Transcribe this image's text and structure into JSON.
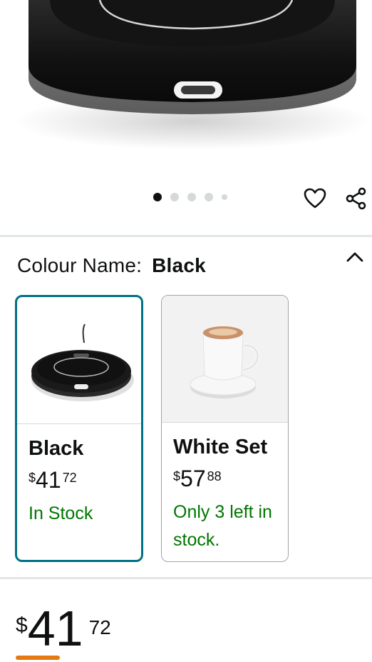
{
  "hero": {
    "image": "black-cup-warmer-closeup"
  },
  "carousel": {
    "total": 5,
    "active_index": 0
  },
  "actions": {
    "wishlist_icon": "heart-icon",
    "share_icon": "share-icon"
  },
  "colour": {
    "label": "Colour Name:",
    "selected": "Black",
    "collapse_icon": "chevron-up-icon"
  },
  "options": [
    {
      "name": "Black",
      "currency": "$",
      "price_whole": "41",
      "price_fraction": "72",
      "stock": "In Stock",
      "selected": true
    },
    {
      "name": "White Set",
      "currency": "$",
      "price_whole": "57",
      "price_fraction": "88",
      "stock": "Only 3 left in stock.",
      "selected": false
    }
  ],
  "price": {
    "currency": "$",
    "whole": "41",
    "fraction": "72"
  },
  "colors": {
    "accent": "#007185",
    "in_stock": "#007600",
    "deal_underline": "#e47911"
  }
}
